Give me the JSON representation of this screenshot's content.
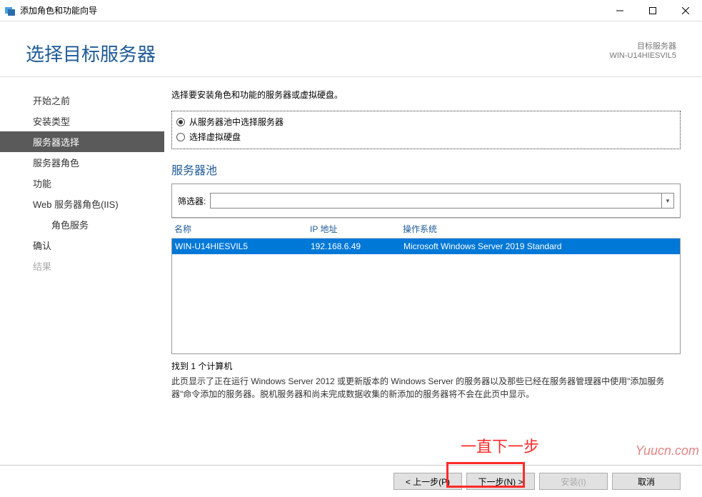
{
  "window": {
    "title": "添加角色和功能向导"
  },
  "header": {
    "title": "选择目标服务器",
    "target_label": "目标服务器",
    "target_value": "WIN-U14HIESVIL5"
  },
  "sidebar": {
    "items": [
      {
        "label": "开始之前"
      },
      {
        "label": "安装类型"
      },
      {
        "label": "服务器选择"
      },
      {
        "label": "服务器角色"
      },
      {
        "label": "功能"
      },
      {
        "label": "Web 服务器角色(IIS)"
      },
      {
        "label": "角色服务"
      },
      {
        "label": "确认"
      },
      {
        "label": "结果"
      }
    ]
  },
  "main": {
    "instruction": "选择要安装角色和功能的服务器或虚拟硬盘。",
    "radio1": "从服务器池中选择服务器",
    "radio2": "选择虚拟硬盘",
    "pool_title": "服务器池",
    "filter_label": "筛选器:",
    "columns": {
      "name": "名称",
      "ip": "IP 地址",
      "os": "操作系统"
    },
    "row": {
      "name": "WIN-U14HIESVIL5",
      "ip": "192.168.6.49",
      "os": "Microsoft Windows Server 2019 Standard"
    },
    "count": "找到 1 个计算机",
    "description": "此页显示了正在运行 Windows Server 2012 或更新版本的 Windows Server 的服务器以及那些已经在服务器管理器中使用\"添加服务器\"命令添加的服务器。脱机服务器和尚未完成数据收集的新添加的服务器将不会在此页中显示。"
  },
  "buttons": {
    "prev": "< 上一步(P)",
    "next": "下一步(N) >",
    "install": "安装(I)",
    "cancel": "取消"
  },
  "annotation": {
    "text": "一直下一步",
    "watermark": "Yuucn.com"
  }
}
